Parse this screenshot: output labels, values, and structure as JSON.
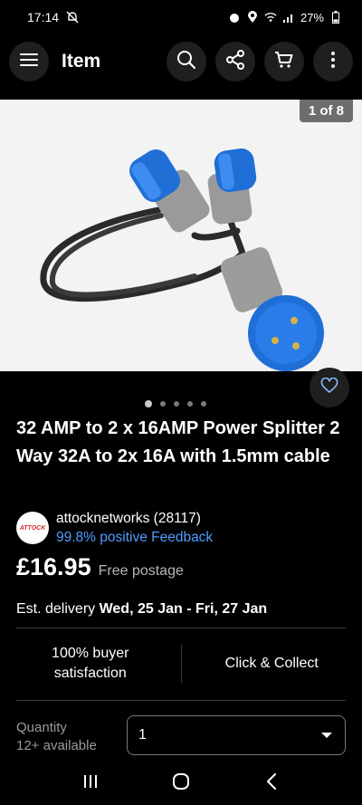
{
  "status": {
    "time": "17:14",
    "battery": "27%"
  },
  "app_bar": {
    "title": "Item"
  },
  "gallery": {
    "counter": "1 of 8",
    "dots_count": 5
  },
  "product": {
    "title": "32 AMP to 2 x 16AMP  Power Splitter 2 Way 32A to 2x 16A with 1.5mm cable"
  },
  "seller": {
    "logo_text": "ATTOCK",
    "name": "attocknetworks (28117)",
    "feedback": "99.8% positive Feedback"
  },
  "price": {
    "amount": "£16.95",
    "postage": "Free postage"
  },
  "delivery": {
    "label": "Est. delivery",
    "dates": "Wed, 25 Jan - Fri, 27 Jan"
  },
  "features": {
    "satisfaction_line1": "100% buyer",
    "satisfaction_line2": "satisfaction",
    "collect": "Click & Collect"
  },
  "quantity": {
    "label": "Quantity",
    "available": "12+ available",
    "value": "1"
  },
  "colors": {
    "background": "#000000",
    "link": "#4f9dff",
    "plug_blue": "#1f6fd6"
  }
}
